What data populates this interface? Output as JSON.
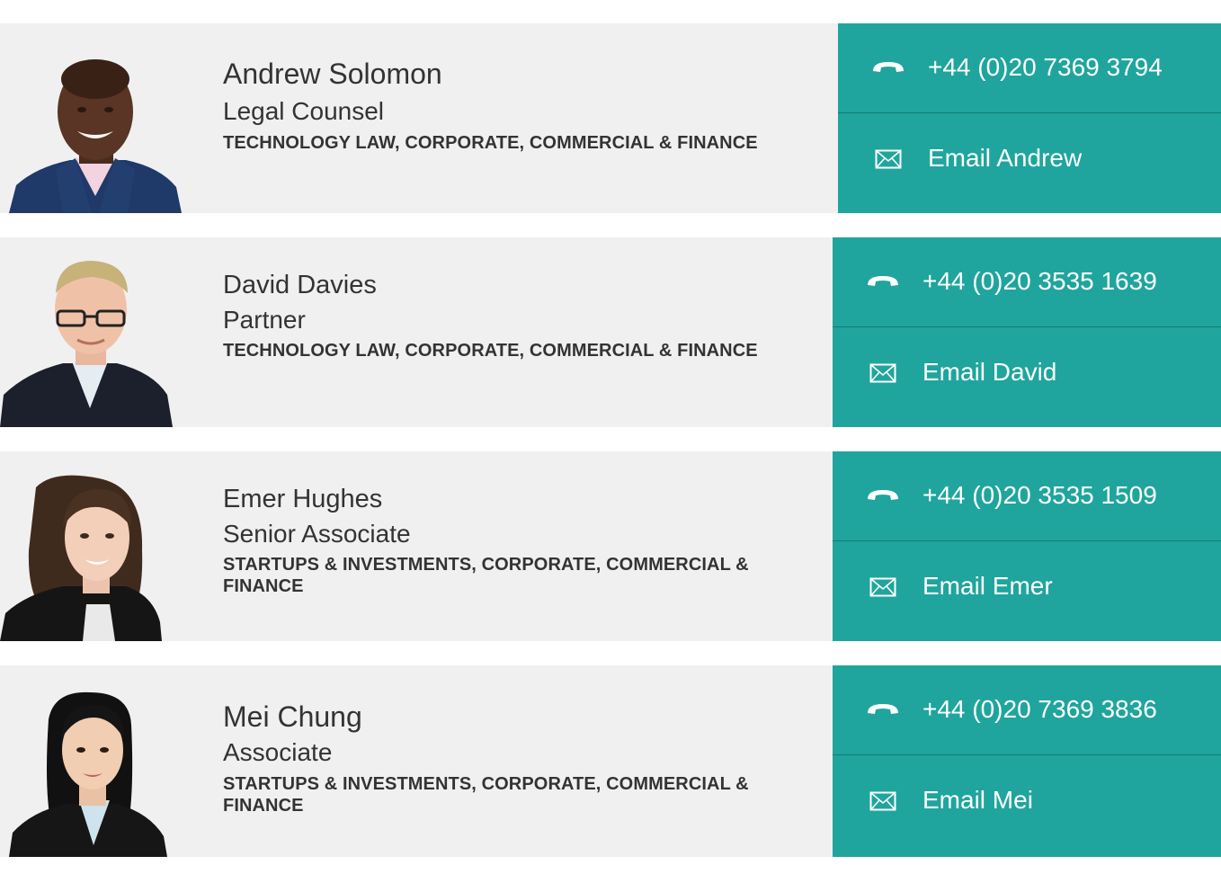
{
  "people": [
    {
      "name": "Andrew Solomon",
      "role": "Legal Counsel",
      "practice": "TECHNOLOGY LAW, CORPORATE, COMMERCIAL & FINANCE",
      "phone": "+44 (0)20 7369 3794",
      "email_label": "Email Andrew",
      "phone_icon": "phone-icon",
      "email_icon": "envelope-icon"
    },
    {
      "name": "David Davies",
      "role": "Partner",
      "practice": "TECHNOLOGY LAW, CORPORATE, COMMERCIAL & FINANCE",
      "phone": "+44 (0)20 3535 1639",
      "email_label": "Email David",
      "phone_icon": "phone-icon",
      "email_icon": "envelope-icon"
    },
    {
      "name": "Emer Hughes",
      "role": "Senior Associate",
      "practice": "STARTUPS & INVESTMENTS, CORPORATE, COMMERCIAL & FINANCE",
      "phone": "+44 (0)20 3535 1509",
      "email_label": "Email Emer",
      "phone_icon": "phone-icon",
      "email_icon": "envelope-icon"
    },
    {
      "name": "Mei Chung",
      "role": "Associate",
      "practice": "STARTUPS & INVESTMENTS, CORPORATE, COMMERCIAL & FINANCE",
      "phone": "+44 (0)20 7369 3836",
      "email_label": "Email Mei",
      "phone_icon": "phone-icon",
      "email_icon": "envelope-icon"
    }
  ],
  "colors": {
    "accent": "#1fa59d",
    "card_bg": "#f0f0f0",
    "text": "#333333"
  }
}
